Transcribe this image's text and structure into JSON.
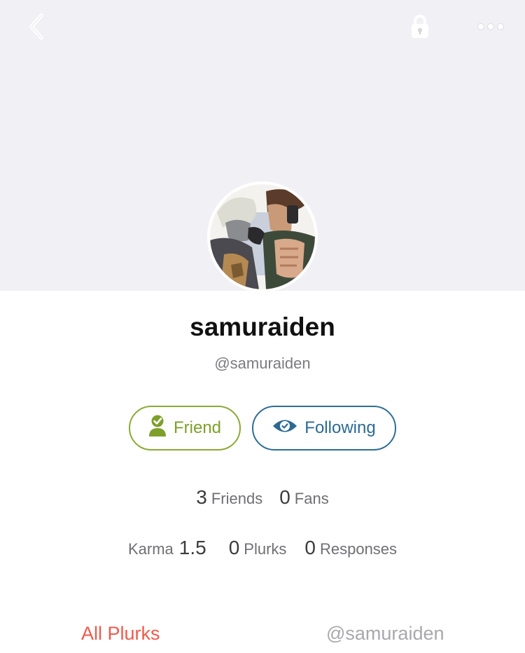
{
  "header": {
    "back_icon": "chevron-left-icon",
    "lock_icon": "lock-icon",
    "more_icon": "more-dots-icon"
  },
  "profile": {
    "display_name": "samuraiden",
    "handle": "@samuraiden"
  },
  "actions": {
    "friend_label": "Friend",
    "following_label": "Following",
    "friend_color": "#8aaa34",
    "following_color": "#2e6e96"
  },
  "stats": {
    "friends_count": "3",
    "friends_label": "Friends",
    "fans_count": "0",
    "fans_label": "Fans",
    "karma_label": "Karma",
    "karma_value": "1.5",
    "plurks_count": "0",
    "plurks_label": "Plurks",
    "responses_count": "0",
    "responses_label": "Responses"
  },
  "tabs": [
    {
      "label": "All Plurks",
      "active": true
    },
    {
      "label": "@samuraiden",
      "active": false
    }
  ],
  "colors": {
    "accent": "#ef5a4c",
    "cover_bg": "#f1f0f4"
  }
}
